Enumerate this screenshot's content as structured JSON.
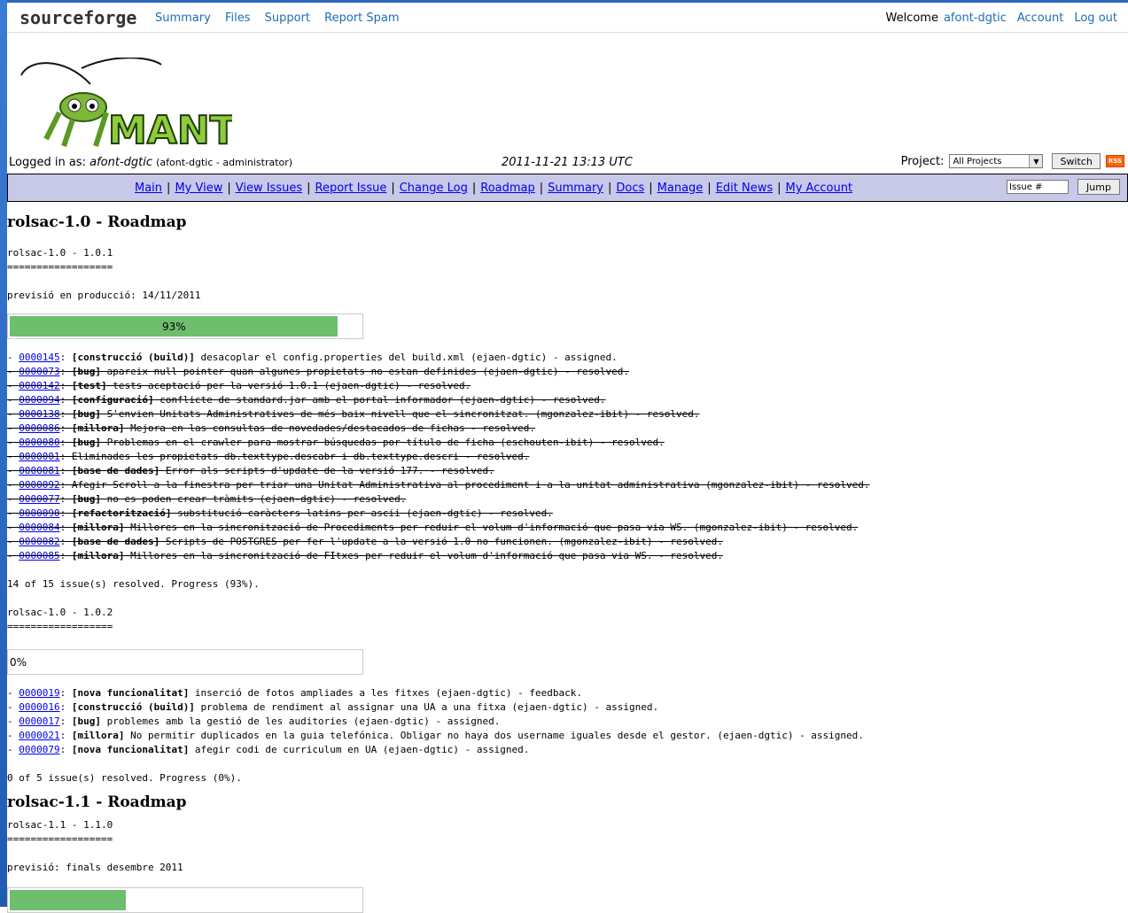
{
  "sourceforge": {
    "logo": "sourceforge",
    "nav": [
      "Summary",
      "Files",
      "Support",
      "Report Spam"
    ],
    "welcome": "Welcome",
    "user": "afont-dgtic",
    "account": "Account",
    "logout": "Log out"
  },
  "header": {
    "logo_text": "MANTIS",
    "logged_in_label": "Logged in as:",
    "username": "afont-dgtic",
    "user_detail": "(afont-dgtic - administrator)",
    "datetime": "2011-11-21 13:13 UTC",
    "project_label": "Project:",
    "project_value": "All Projects",
    "switch_label": "Switch",
    "rss_label": "RSS"
  },
  "menu": {
    "items": [
      "Main",
      "My View",
      "View Issues",
      "Report Issue",
      "Change Log",
      "Roadmap",
      "Summary",
      "Docs",
      "Manage",
      "Edit News",
      "My Account"
    ],
    "issue_placeholder": "Issue #",
    "jump_label": "Jump"
  },
  "colors": {
    "menu_bg": "#c8c8e8",
    "progress": "#6ebe6e",
    "link": "#0000ee"
  },
  "roadmap": {
    "title_10": "rolsac-1.0 - Roadmap",
    "v101": {
      "heading": "rolsac-1.0 - 1.0.1",
      "underline": "==================",
      "forecast": "previsió en producció: 14/11/2011",
      "progress_label": "93%",
      "progress": 0.93,
      "issues": [
        {
          "id": "0000145",
          "cat": "[construcció (build)]",
          "text": " desacoplar el config.properties del build.xml (ejaen-dgtic) - assigned.",
          "done": false
        },
        {
          "id": "0000073",
          "cat": "[bug]",
          "text": " apareix null pointer quan algunes propietats no estan definides (ejaen-dgtic) - resolved.",
          "done": true
        },
        {
          "id": "0000142",
          "cat": "[test]",
          "text": " tests aceptació per la versió 1.0.1 (ejaen-dgtic) - resolved.",
          "done": true
        },
        {
          "id": "0000094",
          "cat": "[configuració]",
          "text": " conflicte de standard.jar amb el portal informador (ejaen-dgtic) - resolved.",
          "done": true
        },
        {
          "id": "0000138",
          "cat": "[bug]",
          "text": " S'envien Unitats Administratives de més baix nivell que el sincronitzat. (mgonzalez-ibit) - resolved.",
          "done": true
        },
        {
          "id": "0000086",
          "cat": "[millora]",
          "text": " Mejora en las consultas de novedades/destacados de fichas - resolved.",
          "done": true
        },
        {
          "id": "0000080",
          "cat": "[bug]",
          "text": " Problemas en el crawler para mostrar búsquedas por título de ficha (eschouten-ibit) - resolved.",
          "done": true
        },
        {
          "id": "0000001",
          "cat": "",
          "text": ": Eliminades les propietats db.texttype.descabr i db.texttype.descri - resolved.",
          "done": true
        },
        {
          "id": "0000081",
          "cat": "[base de dades]",
          "text": " Error als scripts d'update de la versió 177. - resolved.",
          "done": true
        },
        {
          "id": "0000092",
          "cat": "",
          "text": ": Afegir Scroll a la finestra per triar una Unitat Administrativa al procediment i a la unitat administrativa (mgonzalez-ibit) - resolved.",
          "done": true
        },
        {
          "id": "0000077",
          "cat": "[bug]",
          "text": " no es poden crear tràmits (ejaen-dgtic) - resolved.",
          "done": true
        },
        {
          "id": "0000090",
          "cat": "[refactorització]",
          "text": " substitució caràcters latins per ascii (ejaen-dgtic) - resolved.",
          "done": true
        },
        {
          "id": "0000084",
          "cat": "[millora]",
          "text": " Millores en la sincronització de Procediments per reduir el volum d'informació que pasa via WS. (mgonzalez-ibit) - resolved.",
          "done": true
        },
        {
          "id": "0000082",
          "cat": "[base de dades]",
          "text": " Scripts de POSTGRES per fer l'update a la versió 1.0 no funcionen. (mgonzalez-ibit) - resolved.",
          "done": true
        },
        {
          "id": "0000085",
          "cat": "[millora]",
          "text": " Millores en la sincronització de FItxes per reduir el volum d'informació que pasa via WS. - resolved.",
          "done": true
        }
      ],
      "summary": "14 of 15 issue(s) resolved. Progress (93%)."
    },
    "v102": {
      "heading": "rolsac-1.0 - 1.0.2",
      "underline": "==================",
      "progress_label": "0%",
      "progress": 0,
      "issues": [
        {
          "id": "0000019",
          "cat": "[nova funcionalitat]",
          "text": " inserció de fotos ampliades a les fitxes (ejaen-dgtic) - feedback.",
          "done": false
        },
        {
          "id": "0000016",
          "cat": "[construcció (build)]",
          "text": " problema de rendiment al assignar una UA a una fitxa (ejaen-dgtic) - assigned.",
          "done": false
        },
        {
          "id": "0000017",
          "cat": "[bug]",
          "text": " problemes amb la gestió de les auditories (ejaen-dgtic) - assigned.",
          "done": false
        },
        {
          "id": "0000021",
          "cat": "[millora]",
          "text": " No permitir duplicados en la guia telefónica. Obligar no haya dos username iguales desde el gestor. (ejaen-dgtic) - assigned.",
          "done": false
        },
        {
          "id": "0000079",
          "cat": "[nova funcionalitat]",
          "text": " afegir codi de curriculum en UA (ejaen-dgtic) - assigned.",
          "done": false
        }
      ],
      "summary": "0 of 5 issue(s) resolved. Progress (0%)."
    },
    "title_11": "rolsac-1.1 - Roadmap",
    "v110": {
      "heading": "rolsac-1.1 - 1.1.0",
      "underline": "==================",
      "forecast": "previsió: finals desembre 2011",
      "progress": 0.33
    }
  }
}
